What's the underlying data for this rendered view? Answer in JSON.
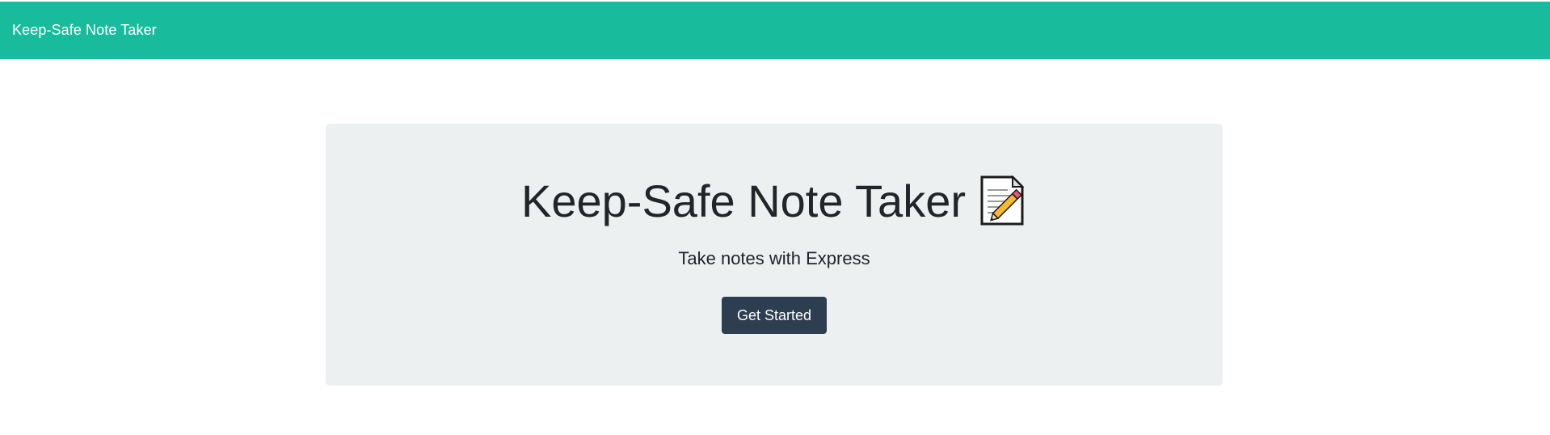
{
  "navbar": {
    "brand": "Keep-Safe Note Taker"
  },
  "hero": {
    "title": "Keep-Safe Note Taker",
    "icon": "memo-icon",
    "subtitle": "Take notes with Express",
    "cta_label": "Get Started"
  },
  "colors": {
    "navbar_bg": "#18bc9c",
    "hero_bg": "#ecf0f1",
    "button_bg": "#2c3e50"
  }
}
